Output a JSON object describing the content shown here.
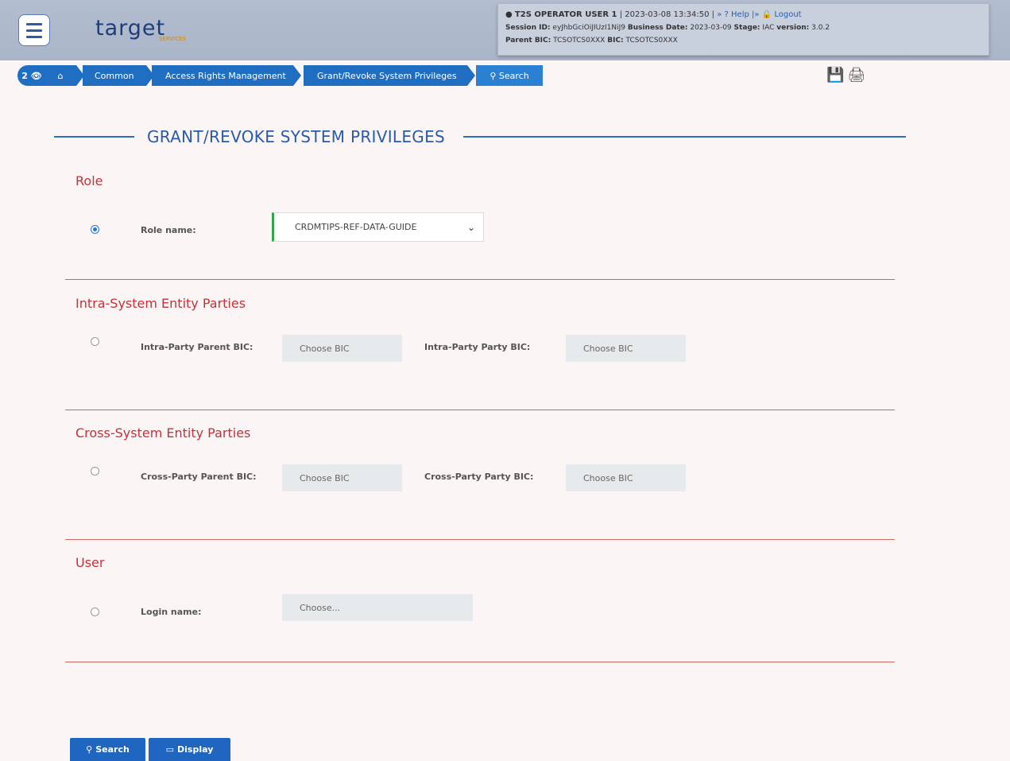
{
  "header": {
    "logo": "target",
    "logo_sub": "SERVICES",
    "user": "T2S OPERATOR USER 1",
    "datetime": "| 2023-03-08 13:34:50 |",
    "help": "Help",
    "logout": "Logout",
    "session_label": "Session ID:",
    "session_id": "eyJhbGciOiJIUzI1NiJ9",
    "business_date_label": "Business Date:",
    "business_date": "2023-03-09",
    "stage_label": "Stage:",
    "stage": "IAC",
    "version_label": "version:",
    "version": "3.0.2",
    "parent_bic_label": "Parent BIC:",
    "parent_bic": "TCSOTCS0XXX",
    "bic_label": "BIC:",
    "bic": "TCSOTCS0XXX"
  },
  "breadcrumb": {
    "badge": "2",
    "items": [
      "Common",
      "Access Rights Management",
      "Grant/Revoke System Privileges"
    ],
    "search": "Search"
  },
  "page_title": "GRANT/REVOKE SYSTEM PRIVILEGES",
  "sections": {
    "role": {
      "title": "Role",
      "label": "Role name:",
      "value": "CRDMTIPS-REF-DATA-GUIDE",
      "selected": true
    },
    "intra": {
      "title": "Intra-System Entity Parties",
      "parent_label": "Intra-Party Parent BIC:",
      "parent_placeholder": "Choose BIC",
      "party_label": "Intra-Party Party BIC:",
      "party_placeholder": "Choose BIC"
    },
    "cross": {
      "title": "Cross-System Entity Parties",
      "parent_label": "Cross-Party Parent BIC:",
      "parent_placeholder": "Choose BIC",
      "party_label": "Cross-Party Party BIC:",
      "party_placeholder": "Choose BIC"
    },
    "user": {
      "title": "User",
      "label": "Login name:",
      "placeholder": "Choose..."
    }
  },
  "buttons": {
    "search": "Search",
    "display": "Display"
  }
}
